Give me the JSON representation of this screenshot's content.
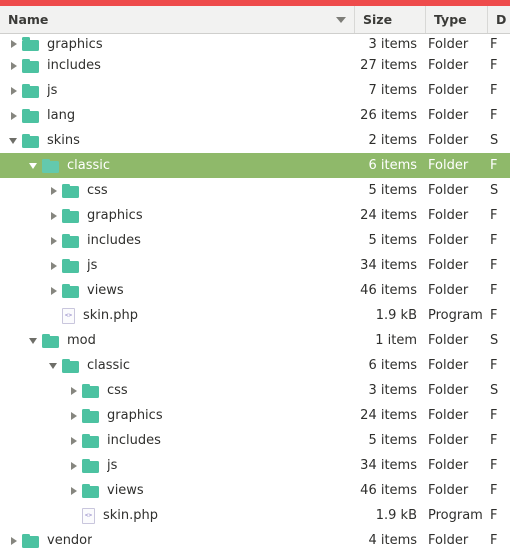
{
  "window": {
    "accent_bar_color": "#ee4b4b",
    "selection_color": "#8fb96a",
    "folder_icon_color": "#4cc2a1"
  },
  "columns": {
    "name": "Name",
    "size": "Size",
    "type": "Type",
    "date": "D",
    "sort_indicator": "descending-caret"
  },
  "rows": [
    {
      "name": "graphics",
      "indent": 0,
      "expander": "collapsed",
      "icon": "folder-icon",
      "size": "3 items",
      "type": "Folder",
      "date": "F",
      "selected": false,
      "clipped": true
    },
    {
      "name": "includes",
      "indent": 0,
      "expander": "collapsed",
      "icon": "folder-icon",
      "size": "27 items",
      "type": "Folder",
      "date": "F",
      "selected": false,
      "clipped": false
    },
    {
      "name": "js",
      "indent": 0,
      "expander": "collapsed",
      "icon": "folder-icon",
      "size": "7 items",
      "type": "Folder",
      "date": "F",
      "selected": false,
      "clipped": false
    },
    {
      "name": "lang",
      "indent": 0,
      "expander": "collapsed",
      "icon": "folder-icon",
      "size": "26 items",
      "type": "Folder",
      "date": "F",
      "selected": false,
      "clipped": false
    },
    {
      "name": "skins",
      "indent": 0,
      "expander": "expanded",
      "icon": "folder-icon",
      "size": "2 items",
      "type": "Folder",
      "date": "S",
      "selected": false,
      "clipped": false
    },
    {
      "name": "classic",
      "indent": 1,
      "expander": "expanded",
      "icon": "folder-icon",
      "size": "6 items",
      "type": "Folder",
      "date": "F",
      "selected": true,
      "clipped": false
    },
    {
      "name": "css",
      "indent": 2,
      "expander": "collapsed",
      "icon": "folder-icon",
      "size": "5 items",
      "type": "Folder",
      "date": "S",
      "selected": false,
      "clipped": false
    },
    {
      "name": "graphics",
      "indent": 2,
      "expander": "collapsed",
      "icon": "folder-icon",
      "size": "24 items",
      "type": "Folder",
      "date": "F",
      "selected": false,
      "clipped": false
    },
    {
      "name": "includes",
      "indent": 2,
      "expander": "collapsed",
      "icon": "folder-icon",
      "size": "5 items",
      "type": "Folder",
      "date": "F",
      "selected": false,
      "clipped": false
    },
    {
      "name": "js",
      "indent": 2,
      "expander": "collapsed",
      "icon": "folder-icon",
      "size": "34 items",
      "type": "Folder",
      "date": "F",
      "selected": false,
      "clipped": false
    },
    {
      "name": "views",
      "indent": 2,
      "expander": "collapsed",
      "icon": "folder-icon",
      "size": "46 items",
      "type": "Folder",
      "date": "F",
      "selected": false,
      "clipped": false
    },
    {
      "name": "skin.php",
      "indent": 2,
      "expander": "none",
      "icon": "code-file-icon",
      "size": "1.9 kB",
      "type": "Program",
      "date": "F",
      "selected": false,
      "clipped": false
    },
    {
      "name": "mod",
      "indent": 1,
      "expander": "expanded",
      "icon": "folder-icon",
      "size": "1 item",
      "type": "Folder",
      "date": "S",
      "selected": false,
      "clipped": false
    },
    {
      "name": "classic",
      "indent": 2,
      "expander": "expanded",
      "icon": "folder-icon",
      "size": "6 items",
      "type": "Folder",
      "date": "F",
      "selected": false,
      "clipped": false
    },
    {
      "name": "css",
      "indent": 3,
      "expander": "collapsed",
      "icon": "folder-icon",
      "size": "3 items",
      "type": "Folder",
      "date": "S",
      "selected": false,
      "clipped": false
    },
    {
      "name": "graphics",
      "indent": 3,
      "expander": "collapsed",
      "icon": "folder-icon",
      "size": "24 items",
      "type": "Folder",
      "date": "F",
      "selected": false,
      "clipped": false
    },
    {
      "name": "includes",
      "indent": 3,
      "expander": "collapsed",
      "icon": "folder-icon",
      "size": "5 items",
      "type": "Folder",
      "date": "F",
      "selected": false,
      "clipped": false
    },
    {
      "name": "js",
      "indent": 3,
      "expander": "collapsed",
      "icon": "folder-icon",
      "size": "34 items",
      "type": "Folder",
      "date": "F",
      "selected": false,
      "clipped": false
    },
    {
      "name": "views",
      "indent": 3,
      "expander": "collapsed",
      "icon": "folder-icon",
      "size": "46 items",
      "type": "Folder",
      "date": "F",
      "selected": false,
      "clipped": false
    },
    {
      "name": "skin.php",
      "indent": 3,
      "expander": "none",
      "icon": "code-file-icon",
      "size": "1.9 kB",
      "type": "Program",
      "date": "F",
      "selected": false,
      "clipped": false
    },
    {
      "name": "vendor",
      "indent": 0,
      "expander": "collapsed",
      "icon": "folder-icon",
      "size": "4 items",
      "type": "Folder",
      "date": "F",
      "selected": false,
      "clipped": false
    }
  ]
}
